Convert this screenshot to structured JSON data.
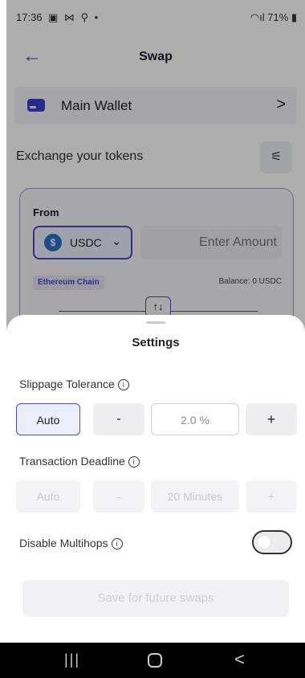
{
  "status": {
    "time": "17:36",
    "icons": "▣ ⋈ ⚲ •",
    "battery": "71%"
  },
  "header": {
    "back_icon": "arrow-left-icon",
    "title": "Swap"
  },
  "wallet": {
    "name": "Main Wallet"
  },
  "exchange": {
    "label": "Exchange your tokens"
  },
  "from_card": {
    "label": "From",
    "token": "USDC",
    "amount_placeholder": "Enter Amount",
    "chain": "Ethereum Chain",
    "balance": "Balance: 0 USDC"
  },
  "settings": {
    "title": "Settings",
    "slippage": {
      "label": "Slippage Tolerance",
      "auto": "Auto",
      "minus": "-",
      "value": "2.0 %",
      "plus": "+"
    },
    "deadline": {
      "label": "Transaction Deadline",
      "auto": "Auto",
      "minus": "-",
      "value": "20 Minutes",
      "plus": "+"
    },
    "multihops": {
      "label": "Disable Multihops",
      "enabled": false
    },
    "save_label": "Save for future swaps"
  },
  "colors": {
    "accent": "#4a49c9",
    "usdc": "#2775ca"
  }
}
